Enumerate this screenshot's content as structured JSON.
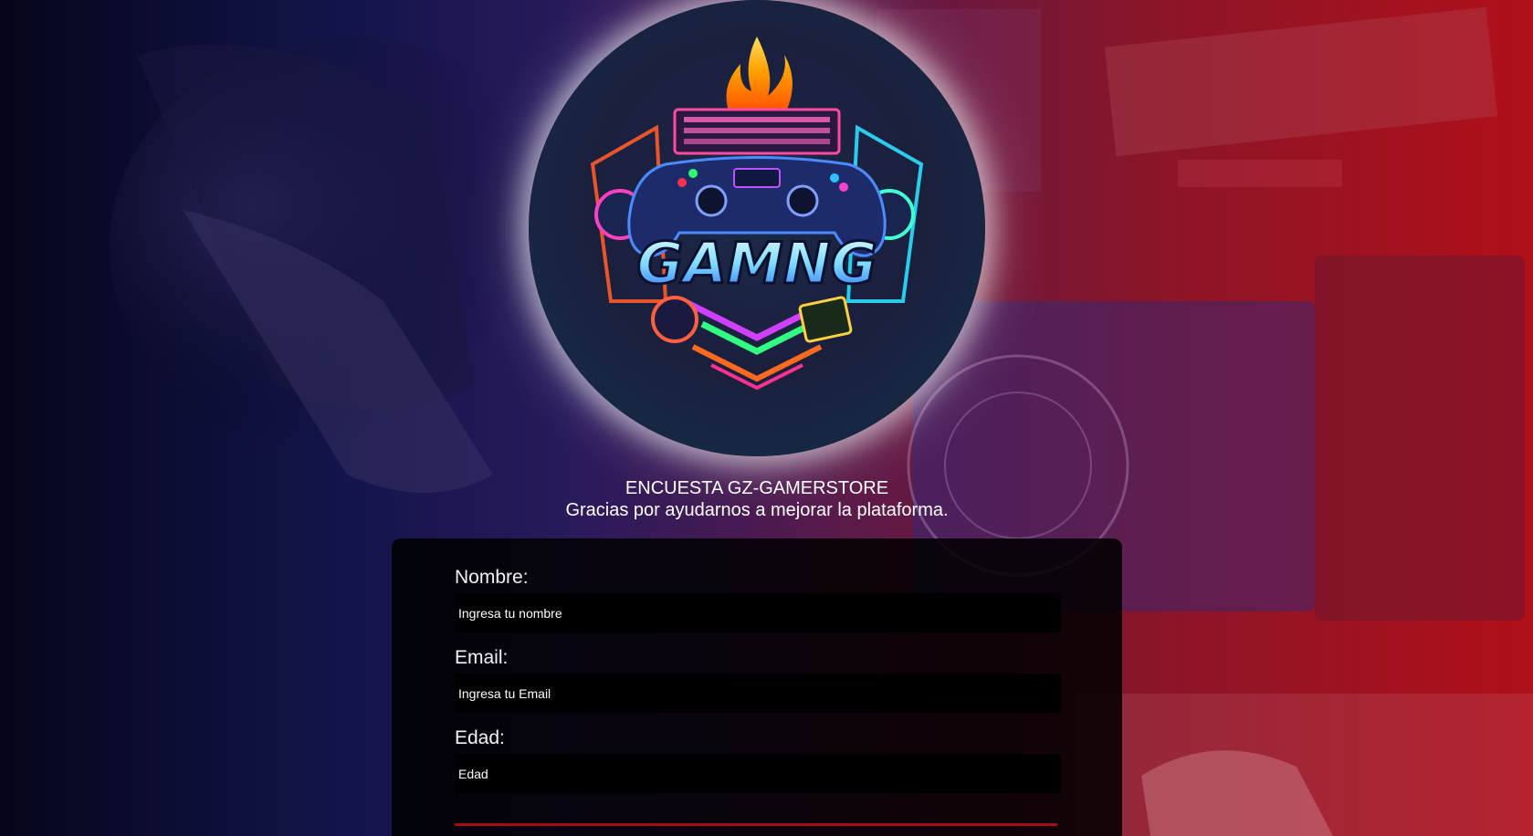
{
  "header": {
    "title": "ENCUESTA GZ-GAMERSTORE",
    "subtitle": "Gracias por ayudarnos a mejorar la plataforma."
  },
  "logo": {
    "text": "GAMNG",
    "icon": "gaming-controller-logo"
  },
  "form": {
    "fields": [
      {
        "label": "Nombre:",
        "placeholder": "Ingresa tu nombre",
        "value": ""
      },
      {
        "label": "Email:",
        "placeholder": "Ingresa tu Email",
        "value": ""
      },
      {
        "label": "Edad:",
        "placeholder": "Edad",
        "value": ""
      }
    ]
  },
  "colors": {
    "background_left": "#0a0b2a",
    "background_right": "#b0101a",
    "card": "#000000",
    "accent": "#a30d14"
  }
}
